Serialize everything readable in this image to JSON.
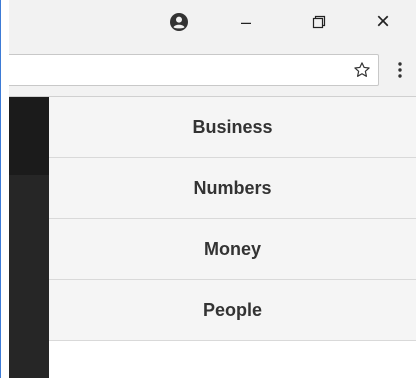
{
  "window_controls": {
    "profile_icon": "account-circle-icon",
    "minimize_glyph": "–",
    "close_glyph": "×"
  },
  "toolbar": {
    "bookmark_icon": "star-outline-icon",
    "menu_icon": "vertical-ellipsis-icon"
  },
  "menu": {
    "items": [
      {
        "label": "Business"
      },
      {
        "label": "Numbers"
      },
      {
        "label": "Money"
      },
      {
        "label": "People"
      }
    ]
  },
  "colors": {
    "sidebar_dark": "#262626",
    "menu_bg": "#f5f5f5",
    "menu_text": "#333333",
    "window_border": "#3d7bd6"
  }
}
